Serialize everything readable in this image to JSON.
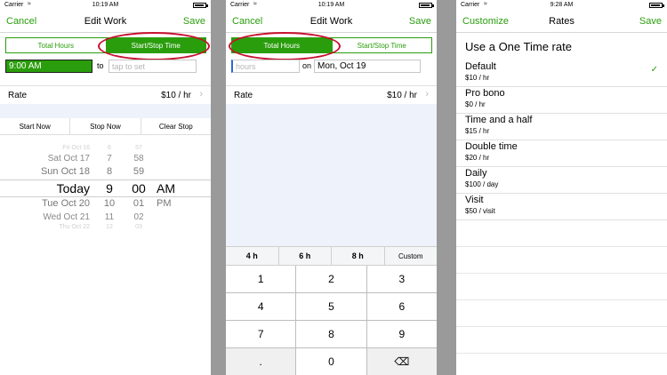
{
  "status": {
    "carrier": "Carrier",
    "wifi": "≈"
  },
  "phone1": {
    "time": "10:19 AM",
    "nav": {
      "left": "Cancel",
      "title": "Edit Work",
      "right": "Save"
    },
    "segments": [
      "Total Hours",
      "Start/Stop Time"
    ],
    "start_value": "9:00 AM",
    "to_label": "to",
    "end_placeholder": "tap to set",
    "rate": {
      "label": "Rate",
      "value": "$10 / hr",
      "chevron": "›"
    },
    "buttons": [
      "Start Now",
      "Stop Now",
      "Clear Stop"
    ],
    "picker": {
      "rows": [
        {
          "day": "Fri Oct 16",
          "hour": "6",
          "min": "57",
          "ampm": ""
        },
        {
          "day": "Sat Oct 17",
          "hour": "7",
          "min": "58",
          "ampm": ""
        },
        {
          "day": "Sun Oct 18",
          "hour": "8",
          "min": "59",
          "ampm": ""
        },
        {
          "day": "Today",
          "hour": "9",
          "min": "00",
          "ampm": "AM"
        },
        {
          "day": "Tue Oct 20",
          "hour": "10",
          "min": "01",
          "ampm": "PM"
        },
        {
          "day": "Wed Oct 21",
          "hour": "11",
          "min": "02",
          "ampm": ""
        },
        {
          "day": "Thu Oct 22",
          "hour": "12",
          "min": "03",
          "ampm": ""
        }
      ]
    }
  },
  "phone2": {
    "time": "10:19 AM",
    "nav": {
      "left": "Cancel",
      "title": "Edit Work",
      "right": "Save"
    },
    "segments": [
      "Total Hours",
      "Start/Stop Time"
    ],
    "hours_placeholder": "hours",
    "on_label": "on",
    "date_value": "Mon, Oct 19",
    "rate": {
      "label": "Rate",
      "value": "$10 / hr",
      "chevron": "›"
    },
    "presets": [
      "4 h",
      "6 h",
      "8 h",
      "Custom"
    ],
    "keys": [
      "1",
      "2",
      "3",
      "4",
      "5",
      "6",
      "7",
      "8",
      "9",
      ".",
      "0",
      "⌫"
    ]
  },
  "phone3": {
    "time": "9:28 AM",
    "nav": {
      "left": "Customize",
      "title": "Rates",
      "right": "Save"
    },
    "header": "Use a One Time rate",
    "check": "✓",
    "items": [
      {
        "name": "Default",
        "sub": "$10 / hr"
      },
      {
        "name": "Pro bono",
        "sub": "$0 / hr"
      },
      {
        "name": "Time and a half",
        "sub": "$15 / hr"
      },
      {
        "name": "Double time",
        "sub": "$20 / hr"
      },
      {
        "name": "Daily",
        "sub": "$100 / day"
      },
      {
        "name": "Visit",
        "sub": "$50 / visit"
      }
    ]
  },
  "colors": {
    "accent": "#2a9d0c",
    "highlight": "#c8102e"
  }
}
